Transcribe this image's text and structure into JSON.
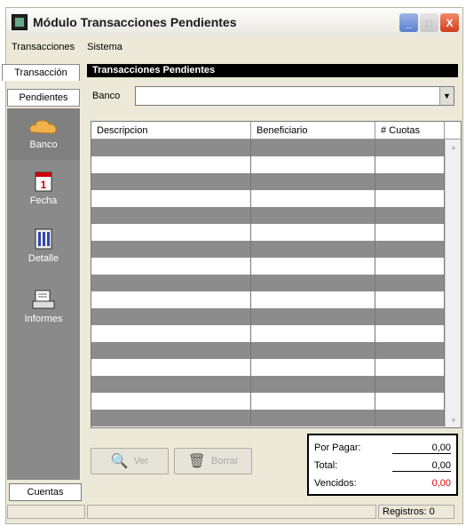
{
  "window": {
    "title": "Módulo Transacciones Pendientes",
    "buttons": {
      "min": "_",
      "max": "□",
      "close": "X"
    }
  },
  "menu": {
    "items": [
      "Transacciones",
      "Sistema"
    ]
  },
  "left_tabs": {
    "top": "Transacción",
    "active": "Pendientes",
    "bottom": "Cuentas"
  },
  "sidebar": {
    "items": [
      {
        "label": "Banco",
        "icon": "cloud-icon",
        "active": true
      },
      {
        "label": "Fecha",
        "icon": "calendar-icon",
        "active": false
      },
      {
        "label": "Detalle",
        "icon": "detail-icon",
        "active": false
      },
      {
        "label": "Informes",
        "icon": "report-icon",
        "active": false
      }
    ]
  },
  "panel": {
    "title": "Transacciones Pendientes"
  },
  "banco": {
    "label": "Banco",
    "value": ""
  },
  "grid": {
    "columns": [
      "Descripcion",
      "Beneficiario",
      "# Cuotas"
    ],
    "rows": 17
  },
  "buttons": {
    "ver": "Ver",
    "borrar": "Borrar"
  },
  "summary": {
    "por_pagar_label": "Por Pagar:",
    "por_pagar": "0,00",
    "total_label": "Total:",
    "total": "0,00",
    "vencidos_label": "Vencidos:",
    "vencidos": "0,00"
  },
  "status": {
    "registros": "Registros: 0"
  },
  "colors": {
    "accent": "#000000",
    "sidebar": "#8a8a8a",
    "red": "#dd0000"
  }
}
